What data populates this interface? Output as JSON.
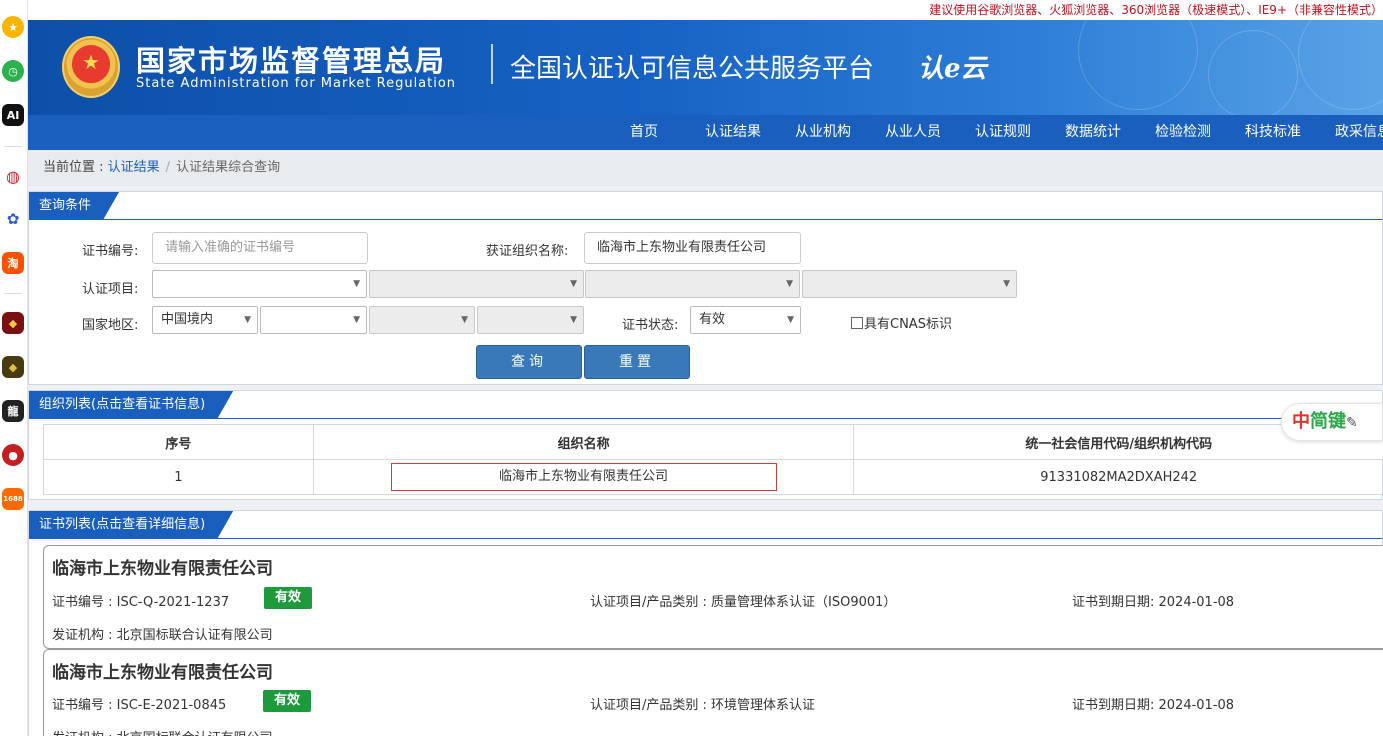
{
  "notice": "建议使用谷歌浏览器、火狐浏览器、360浏览器（极速模式）、IE9+（非兼容性模式）",
  "header": {
    "agency_cn": "国家市场监督管理总局",
    "agency_en": "State Administration  for  Market Regulation",
    "platform": "全国认证认可信息公共服务平台",
    "logo_text": "认e云"
  },
  "sidebar": {
    "icons": [
      "star-icon",
      "clock-icon",
      "ai-icon",
      "swirl-icon",
      "paw-icon",
      "taobao-icon",
      "game-icon-1",
      "game-icon-2",
      "dragon-icon",
      "ball-icon",
      "store-1688-icon"
    ],
    "labels": {
      "ai": "AI",
      "taobao": "淘",
      "dragon": "龍",
      "store": "1688"
    }
  },
  "nav": {
    "items": [
      "首页",
      "认证结果",
      "从业机构",
      "从业人员",
      "认证规则",
      "数据统计",
      "检验检测",
      "科技标准",
      "政采信息"
    ]
  },
  "breadcrumb": {
    "prefix": "当前位置 : ",
    "link": "认证结果",
    "separator": "/",
    "current": "认证结果综合查询"
  },
  "query": {
    "panel_title": "查询条件",
    "cert_no_label": "证书编号:",
    "cert_no_placeholder": "请输入准确的证书编号",
    "org_label": "获证组织名称:",
    "org_value": "临海市上东物业有限责任公司",
    "project_label": "认证项目:",
    "region_label": "国家地区:",
    "region_value": "中国境内",
    "status_label": "证书状态:",
    "status_value": "有效",
    "cnas_label": "具有CNAS标识",
    "search_button": "查询",
    "reset_button": "重置"
  },
  "org_list": {
    "panel_title": "组织列表(点击查看证书信息)",
    "columns": [
      "序号",
      "组织名称",
      "统一社会信用代码/组织机构代码"
    ],
    "rows": [
      {
        "index": "1",
        "name": "临海市上东物业有限责任公司",
        "code": "91331082MA2DXAH242"
      }
    ]
  },
  "cert_list": {
    "panel_title": "证书列表(点击查看详细信息)",
    "cards": [
      {
        "org": "临海市上东物业有限责任公司",
        "cert_no": "证书编号 : ISC-Q-2021-1237",
        "status": "有效",
        "project": "认证项目/产品类别 : 质量管理体系认证（ISO9001）",
        "expiry": "证书到期日期: 2024-01-08",
        "issuer": "发证机构 : 北京国标联合认证有限公司"
      },
      {
        "org": "临海市上东物业有限责任公司",
        "cert_no": "证书编号 : ISC-E-2021-0845",
        "status": "有效",
        "project": "认证项目/产品类别 : 环境管理体系认证",
        "expiry": "证书到期日期: 2024-01-08",
        "issuer": "发证机构 : 北京国标联合认证有限公司"
      }
    ]
  },
  "float_tool": {
    "text": "中简键"
  },
  "colors": {
    "brand_blue": "#1a5fbe",
    "valid_green": "#1d9a3c",
    "notice_red": "#c1121f"
  }
}
